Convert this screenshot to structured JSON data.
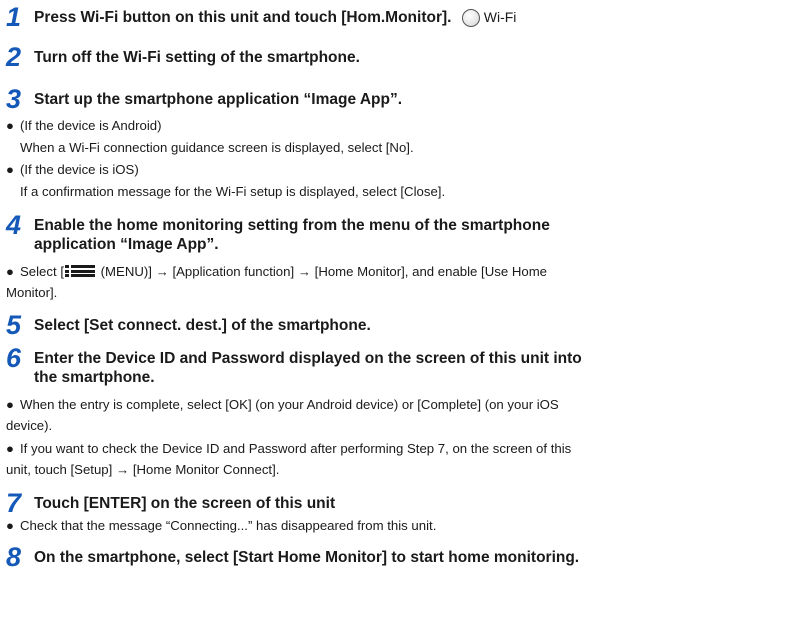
{
  "colors": {
    "step_number": "#1559b8",
    "text": "#1a1a1a"
  },
  "steps": [
    {
      "number": "1",
      "title": "Press Wi-Fi button on this unit and touch [Hom.Monitor].",
      "icon": "wifi-button-icon",
      "icon_label": "Wi-Fi"
    },
    {
      "number": "2",
      "title": "Turn off the Wi-Fi setting of the smartphone."
    },
    {
      "number": "3",
      "title": "Start up the smartphone application “Image App”.",
      "lines": [
        "(If the device is Android)",
        "When a Wi-Fi connection guidance screen is displayed, select [No].",
        "(If the device is iOS)",
        "If a confirmation message for the Wi-Fi setup is displayed, select [Close]."
      ]
    },
    {
      "number": "4",
      "title_line1": "Enable the home monitoring setting from the menu of the smartphone",
      "title_line2": "application “Image App”.",
      "bullet_before_icon": "Select [",
      "icon": "menu-icon",
      "bullet_after_icon": " (MENU)] → [Application function] → [Home Monitor], and enable [Use Home",
      "bullet_cont": "Monitor]."
    },
    {
      "number": "5",
      "title": "Select [Set connect. dest.] of the smartphone."
    },
    {
      "number": "6",
      "title_line1": "Enter the Device ID and Password displayed on the screen of this unit into",
      "title_line2": "the smartphone.",
      "lines": [
        "When the entry is complete, select [OK] (on your Android device) or [Complete] (on your iOS",
        "device).",
        "If you want to check the Device ID and Password after performing Step 7, on the screen of this",
        "unit, touch [Setup] → [Home Monitor Connect]."
      ]
    },
    {
      "number": "7",
      "title": "Touch [ENTER] on the screen of this unit",
      "lines": [
        "Check that the message “Connecting...” has disappeared from this unit."
      ]
    },
    {
      "number": "8",
      "title": "On the smartphone, select [Start Home Monitor] to start home monitoring."
    }
  ]
}
